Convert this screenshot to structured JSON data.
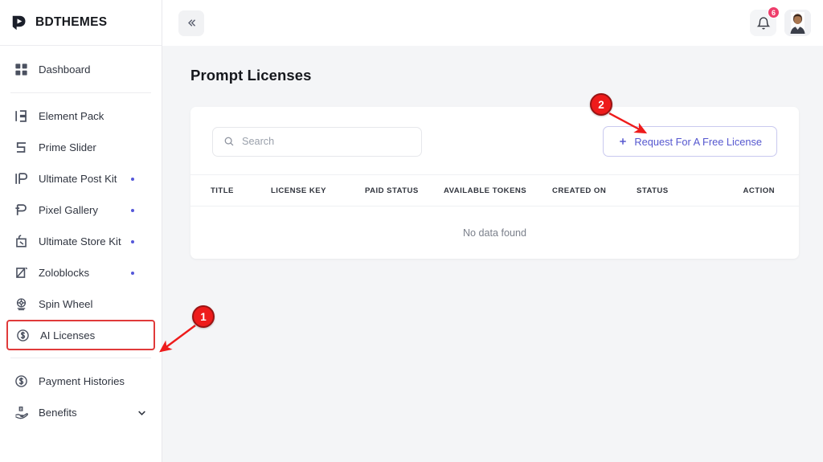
{
  "brand": {
    "name": "BDTHEMES",
    "logo_icon": "bdthemes-logo-icon"
  },
  "sidebar": {
    "items": [
      {
        "label": "Dashboard",
        "icon": "grid-icon",
        "dot": false,
        "chevron": false,
        "highlight": false
      },
      {
        "label": "Element Pack",
        "icon": "element-pack-icon",
        "dot": false,
        "chevron": false,
        "highlight": false
      },
      {
        "label": "Prime Slider",
        "icon": "prime-slider-icon",
        "dot": false,
        "chevron": false,
        "highlight": false
      },
      {
        "label": "Ultimate Post Kit",
        "icon": "ultimate-post-kit-icon",
        "dot": true,
        "chevron": false,
        "highlight": false
      },
      {
        "label": "Pixel Gallery",
        "icon": "pixel-gallery-icon",
        "dot": true,
        "chevron": false,
        "highlight": false
      },
      {
        "label": "Ultimate Store Kit",
        "icon": "ultimate-store-kit-icon",
        "dot": true,
        "chevron": false,
        "highlight": false
      },
      {
        "label": "Zoloblocks",
        "icon": "zoloblocks-icon",
        "dot": true,
        "chevron": false,
        "highlight": false
      },
      {
        "label": "Spin Wheel",
        "icon": "spin-wheel-icon",
        "dot": false,
        "chevron": false,
        "highlight": false
      },
      {
        "label": "AI Licenses",
        "icon": "dollar-circle-icon",
        "dot": false,
        "chevron": false,
        "highlight": true
      },
      {
        "label": "Payment Histories",
        "icon": "dollar-circle-icon",
        "dot": false,
        "chevron": false,
        "highlight": false
      },
      {
        "label": "Benefits",
        "icon": "hand-money-icon",
        "dot": false,
        "chevron": true,
        "highlight": false
      }
    ]
  },
  "topbar": {
    "collapse_icon": "double-chevron-left-icon",
    "bell_icon": "bell-icon",
    "bell_badge": "6",
    "avatar_icon": "user-avatar"
  },
  "main": {
    "page_title": "Prompt Licenses",
    "search": {
      "placeholder": "Search",
      "value": "",
      "icon": "search-icon"
    },
    "request_button": {
      "label": "Request For A Free License",
      "icon": "plus-icon"
    },
    "table": {
      "columns": [
        "TITLE",
        "LICENSE KEY",
        "PAID STATUS",
        "AVAILABLE TOKENS",
        "CREATED ON",
        "STATUS",
        "ACTION"
      ],
      "rows": [],
      "empty_text": "No data found"
    }
  },
  "annotations": {
    "markers": [
      {
        "number": "1",
        "target": "AI Licenses sidebar item"
      },
      {
        "number": "2",
        "target": "Request For A Free License button"
      }
    ],
    "color": "#ee1b1b"
  },
  "colors": {
    "accent": "#5557cf",
    "page_bg": "#f4f5f7",
    "card_bg": "#ffffff",
    "badge": "#ee3d6b",
    "annotation": "#ee1b1b",
    "dot": "#5558d9"
  }
}
